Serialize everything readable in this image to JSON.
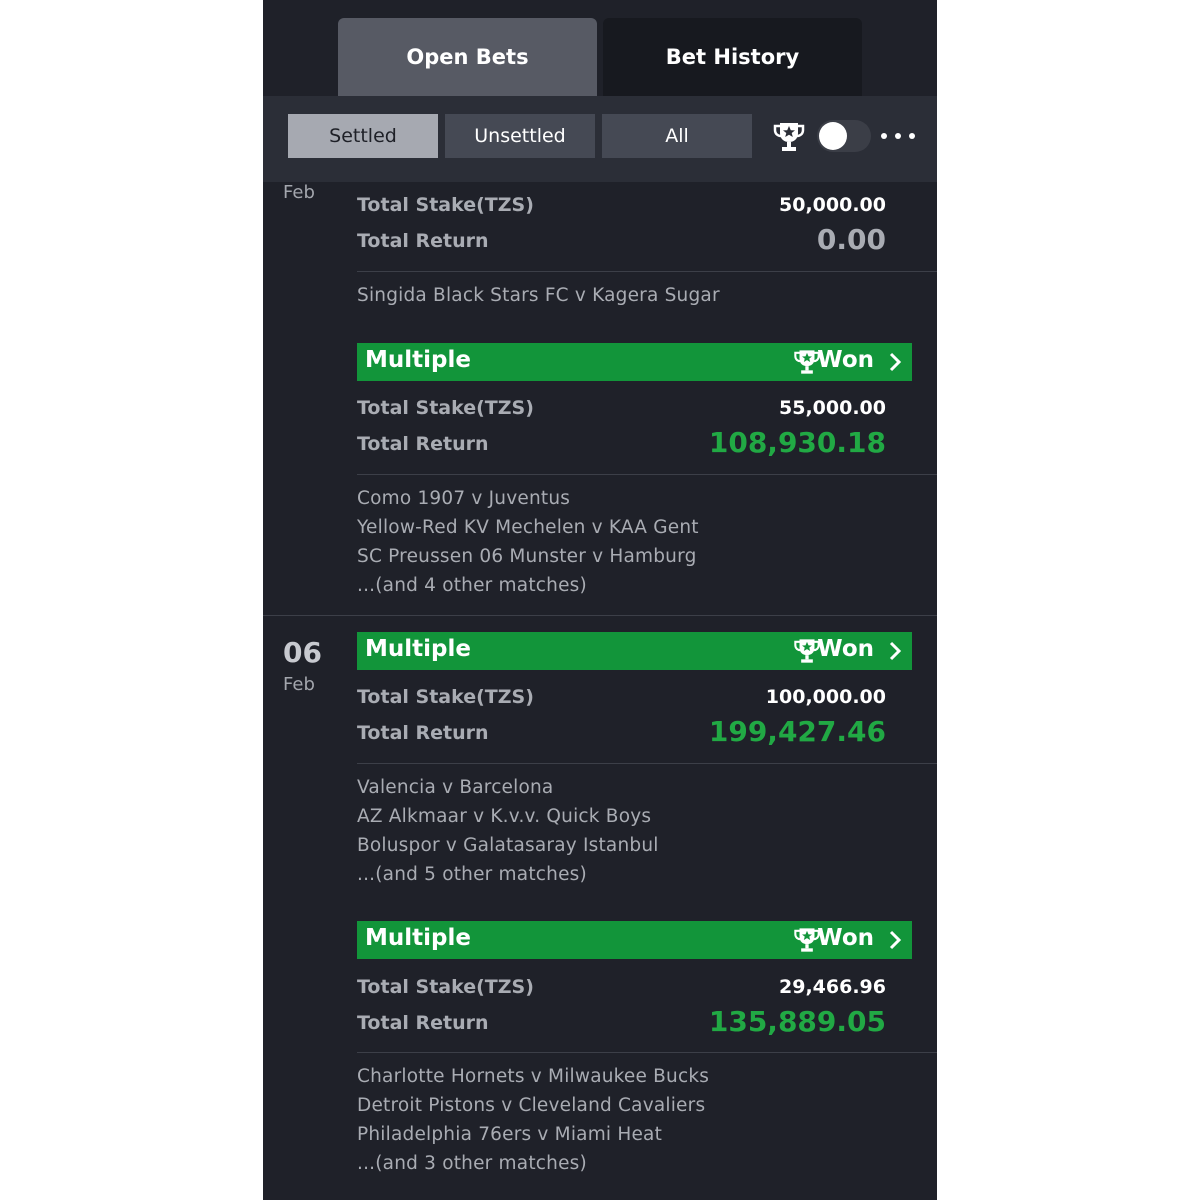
{
  "tabs": {
    "open_bets": "Open Bets",
    "bet_history": "Bet History"
  },
  "filters": {
    "settled": "Settled",
    "unsettled": "Unsettled",
    "all": "All"
  },
  "bets": {
    "b0": {
      "month": "Feb",
      "stake_label": "Total Stake(TZS)",
      "stake": "50,000.00",
      "return_label": "Total Return",
      "return": "0.00",
      "matches": [
        "Singida Black Stars FC v Kagera Sugar"
      ]
    },
    "b1": {
      "type": "Multiple",
      "status": "Won",
      "stake_label": "Total Stake(TZS)",
      "stake": "55,000.00",
      "return_label": "Total Return",
      "return": "108,930.18",
      "matches": [
        "Como 1907 v Juventus",
        "Yellow-Red KV Mechelen v KAA Gent",
        "SC Preussen 06 Munster v Hamburg",
        "...(and 4 other matches)"
      ]
    },
    "b2": {
      "day": "06",
      "month": "Feb",
      "type": "Multiple",
      "status": "Won",
      "stake_label": "Total Stake(TZS)",
      "stake": "100,000.00",
      "return_label": "Total Return",
      "return": "199,427.46",
      "matches": [
        "Valencia v Barcelona",
        "AZ Alkmaar v K.v.v. Quick Boys",
        "Boluspor v Galatasaray Istanbul",
        "...(and 5 other matches)"
      ]
    },
    "b3": {
      "type": "Multiple",
      "status": "Won",
      "stake_label": "Total Stake(TZS)",
      "stake": "29,466.96",
      "return_label": "Total Return",
      "return": "135,889.05",
      "matches": [
        "Charlotte Hornets v Milwaukee Bucks",
        "Detroit Pistons v Cleveland Cavaliers",
        "Philadelphia 76ers v Miami Heat",
        "...(and 3 other matches)"
      ]
    }
  },
  "icons": {
    "trophy": "trophy-icon",
    "chevron": "chevron-right-icon",
    "more": "more-icon"
  },
  "colors": {
    "won_green": "#12953a",
    "return_green": "#21a944",
    "background": "#1f2129"
  }
}
